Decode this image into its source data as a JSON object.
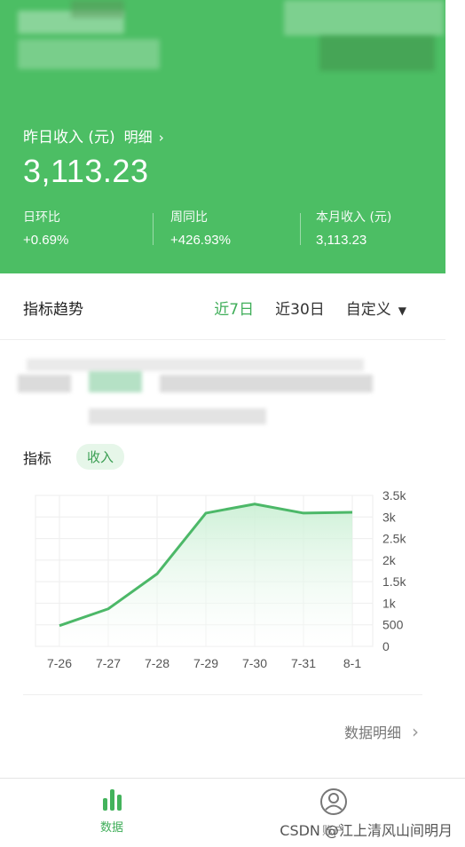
{
  "header": {
    "yesterday_label": "昨日收入 (元)",
    "detail_label": "明细",
    "detail_chevron": "›",
    "amount": "3,113.23",
    "stats": [
      {
        "label": "日环比",
        "value": "+0.69%"
      },
      {
        "label": "周同比",
        "value": "+426.93%"
      },
      {
        "label": "本月收入 (元)",
        "value": "3,113.23"
      }
    ]
  },
  "trend": {
    "title": "指标趋势",
    "tabs": [
      {
        "label": "近7日",
        "active": true
      },
      {
        "label": "近30日",
        "active": false
      },
      {
        "label": "自定义",
        "active": false
      }
    ],
    "dropdown_icon": "caret-down-icon"
  },
  "metric": {
    "label": "指标",
    "pill": "收入"
  },
  "chart_data": {
    "type": "area",
    "categories": [
      "7-26",
      "7-27",
      "7-28",
      "7-29",
      "7-30",
      "7-31",
      "8-1"
    ],
    "values": [
      480,
      870,
      1680,
      3090,
      3300,
      3090,
      3110
    ],
    "ylim": [
      0,
      3500
    ],
    "yticks": [
      "3.5k",
      "3k",
      "2.5k",
      "2k",
      "1.5k",
      "1k",
      "500",
      "0"
    ],
    "ytick_values": [
      3500,
      3000,
      2500,
      2000,
      1500,
      1000,
      500,
      0
    ],
    "grid": true,
    "y_axis_side": "right",
    "color": "#4cb868",
    "fill_color": "#c9efd3"
  },
  "detail_link": {
    "label": "数据明细",
    "arrow": "›"
  },
  "bottom_nav": {
    "data_label": "数据",
    "account_label": "账户"
  },
  "watermark": "CSDN @江上清风山间明月",
  "colors": {
    "brand": "#4cbe64",
    "accent_text": "#3fae59"
  }
}
